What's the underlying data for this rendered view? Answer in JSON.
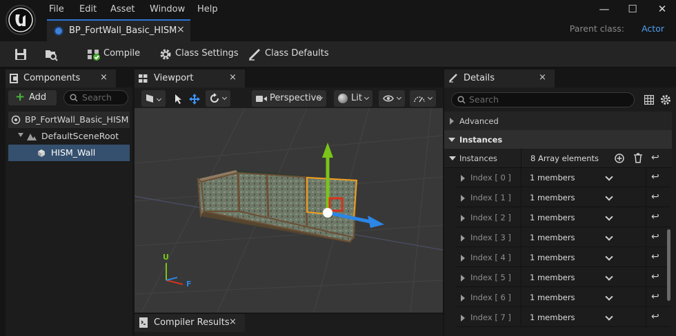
{
  "menu": [
    "File",
    "Edit",
    "Asset",
    "Window",
    "Help"
  ],
  "document_tab": {
    "title": "BP_FortWall_Basic_HISM",
    "close": "×"
  },
  "parent_class": {
    "label": "Parent class:",
    "value": "Actor"
  },
  "window_controls": {
    "minimize": "—",
    "maximize": "☐",
    "close": "✕"
  },
  "toolbar": {
    "compile": "Compile",
    "class_settings": "Class Settings",
    "class_defaults": "Class Defaults"
  },
  "components": {
    "tab": "Components",
    "close": "×",
    "add": "Add",
    "search_placeholder": "Search",
    "tree": [
      "BP_FortWall_Basic_HISM",
      "DefaultSceneRoot",
      "HISM_Wall"
    ]
  },
  "viewport": {
    "tab": "Viewport",
    "close": "×",
    "perspective": "Perspective",
    "lit": "Lit",
    "axis_up": "U",
    "axis_forward": "F"
  },
  "compiler_results": {
    "tab": "Compiler Results",
    "close": "×"
  },
  "details": {
    "tab": "Details",
    "close": "×",
    "search_placeholder": "Search",
    "advanced": "Advanced",
    "instances_category": "Instances",
    "instances_label": "Instances",
    "instances_value": "8 Array elements",
    "elements": [
      {
        "index": "Index [ 0 ]",
        "value": "1 members"
      },
      {
        "index": "Index [ 1 ]",
        "value": "1 members"
      },
      {
        "index": "Index [ 2 ]",
        "value": "1 members"
      },
      {
        "index": "Index [ 3 ]",
        "value": "1 members"
      },
      {
        "index": "Index [ 4 ]",
        "value": "1 members"
      },
      {
        "index": "Index [ 5 ]",
        "value": "1 members"
      },
      {
        "index": "Index [ 6 ]",
        "value": "1 members"
      },
      {
        "index": "Index [ 7 ]",
        "value": "1 members"
      }
    ]
  },
  "colors": {
    "accent_blue": "#2a73d6",
    "selection": "#35506e",
    "gizmo_green": "#7ac41a",
    "gizmo_blue": "#2b86e6",
    "gizmo_red": "#d8321c",
    "selection_outline": "#f0a020"
  }
}
